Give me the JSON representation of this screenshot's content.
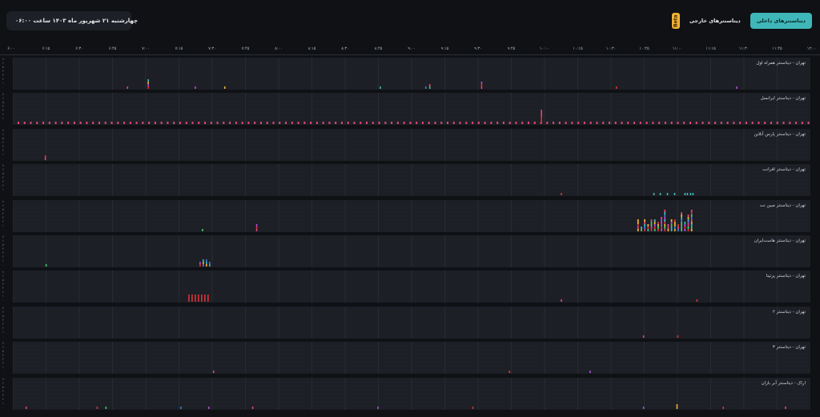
{
  "header": {
    "date_text": "چهارشنبه ۲۱ شهریور ماه ۱۴۰۳ ساعت ۰۶:۰۰",
    "tabs": [
      {
        "label": "دیتاسنترهای داخلی",
        "active": true
      },
      {
        "label": "دیتاسنترهای خارجی",
        "active": false
      }
    ],
    "beta_label": "Beta",
    "accent_color": "#3fb7b9",
    "beta_color": "#f2b134"
  },
  "timeline": {
    "ticks": [
      "۶:۰۰",
      "۶:۱۵",
      "۶:۳۰",
      "۶:۴۵",
      "۷:۰۰",
      "۷:۱۵",
      "۷:۳۰",
      "۷:۴۵",
      "۸:۰۰",
      "۸:۱۵",
      "۸:۳۰",
      "۸:۴۵",
      "۹:۰۰",
      "۹:۱۵",
      "۹:۳۰",
      "۹:۴۵",
      "۱۰:۰۰",
      "۱۰:۱۵",
      "۱۰:۳۰",
      "۱۰:۴۵",
      "۱۱:۰۰",
      "۱۱:۱۵",
      "۱۱:۳۰",
      "۱۱:۴۵",
      "۱۲:۰۰"
    ]
  },
  "y_axis_labels": [
    "۷",
    "۶",
    "۵",
    "۴",
    "۳",
    "۲",
    "۱",
    "۰"
  ],
  "datacenters": [
    {
      "name": "تهران - دیتاسنتر همراه اول"
    },
    {
      "name": "تهران - دیتاسنتر ایرانسل"
    },
    {
      "name": "تهران - دیتاسنتر پارس آنلاین"
    },
    {
      "name": "تهران - دیتاسنتر افرانت"
    },
    {
      "name": "تهران - دیتاسنتر مبین نت"
    },
    {
      "name": "تهران - دیتاسنتر هاست‌ایران"
    },
    {
      "name": "تهران - دیتاسنتر پرتینا"
    },
    {
      "name": "تهران - دیتاسنتر ۲"
    },
    {
      "name": "تهران - دیتاسنتر ۳"
    },
    {
      "name": "اراک - دیتاسنتر آبر بازان"
    }
  ]
}
